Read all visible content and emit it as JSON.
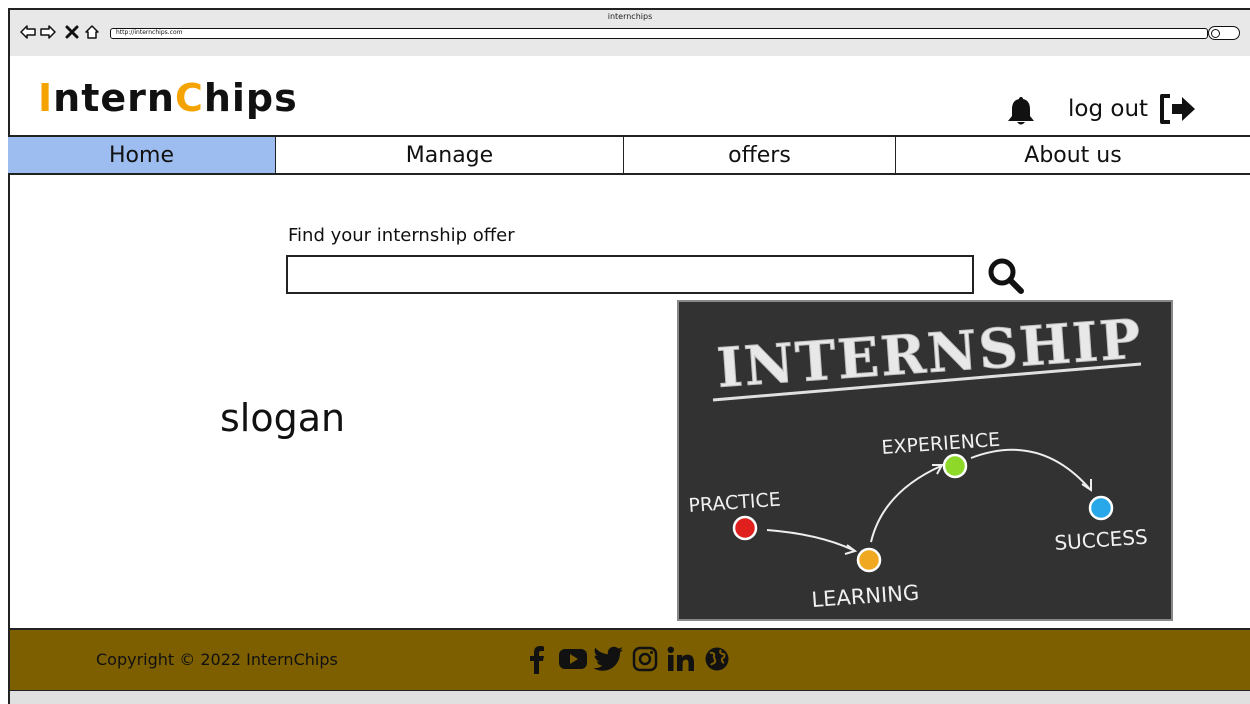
{
  "window": {
    "title": "internchips",
    "url": "http://internchips.com"
  },
  "brand": {
    "part1": "Intern",
    "part2": "Chips",
    "accent_color": "#f5a300"
  },
  "header": {
    "logout_label": "log out",
    "icons": [
      "bell-icon",
      "logout-icon"
    ]
  },
  "nav": {
    "tabs": [
      {
        "label": "Home",
        "active": true
      },
      {
        "label": "Manage",
        "active": false
      },
      {
        "label": "offers",
        "active": false
      },
      {
        "label": "About us",
        "active": false
      }
    ],
    "active_color": "#9dbdf0"
  },
  "search": {
    "label": "Find your internship offer",
    "value": "",
    "placeholder": ""
  },
  "main": {
    "slogan": "slogan"
  },
  "hero": {
    "title": "INTERNSHIP",
    "steps": [
      "PRACTICE",
      "LEARNING",
      "EXPERIENCE",
      "SUCCESS"
    ],
    "step_colors": [
      "#e0201f",
      "#f0a820",
      "#8ed82a",
      "#28a8e8"
    ]
  },
  "footer": {
    "copyright": "Copyright © 2022 InternChips",
    "background": "#7d5f00",
    "social_icons": [
      "facebook-icon",
      "youtube-icon",
      "twitter-icon",
      "instagram-icon",
      "linkedin-icon",
      "globe-icon"
    ]
  }
}
